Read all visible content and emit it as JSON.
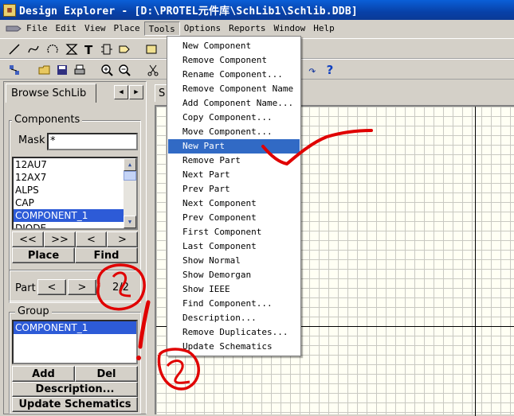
{
  "window": {
    "title": "Design Explorer - [D:\\PROTEL元件库\\SchLib1\\Schlib.DDB]"
  },
  "menubar": {
    "items": [
      {
        "label": "File"
      },
      {
        "label": "Edit"
      },
      {
        "label": "View"
      },
      {
        "label": "Place"
      },
      {
        "label": "Tools"
      },
      {
        "label": "Options"
      },
      {
        "label": "Reports"
      },
      {
        "label": "Window"
      },
      {
        "label": "Help"
      }
    ],
    "active": "Tools"
  },
  "toolbar": {
    "help_glyph": "?",
    "redo_glyph": "↷"
  },
  "panel": {
    "tab_label": "Browse SchLib",
    "components_label": "Components",
    "mask_label": "Mask",
    "mask_value": "*",
    "components": [
      "12AU7",
      "12AX7",
      "ALPS",
      "CAP",
      "COMPONENT_1",
      "DIODE"
    ],
    "selected_component": "COMPONENT_1",
    "nav_first": "<<",
    "nav_last": ">>",
    "nav_prev": "<",
    "nav_next": ">",
    "place_label": "Place",
    "find_label": "Find",
    "part_label": "Part",
    "part_prev": "<",
    "part_next": ">",
    "part_counter": "2/2",
    "group_label": "Group",
    "group_items": [
      "COMPONENT_1"
    ],
    "add_label": "Add",
    "del_label": "Del",
    "description_label": "Description...",
    "update_schematics_label": "Update Schematics"
  },
  "document": {
    "tab_label": "S"
  },
  "tools_menu": {
    "items": [
      "New Component",
      "Remove Component",
      "Rename Component...",
      "Remove Component Name",
      "Add Component Name...",
      "Copy Component...",
      "Move Component...",
      "New Part",
      "Remove Part",
      "Next Part",
      "Prev Part",
      "Next Component",
      "Prev Component",
      "First Component",
      "Last Component",
      "Show Normal",
      "Show Demorgan",
      "Show IEEE",
      "Find Component...",
      "Description...",
      "Remove Duplicates...",
      "Update Schematics"
    ],
    "highlighted": "New Part"
  },
  "colors": {
    "title_bar": "#0a47b8",
    "highlight": "#316ac5",
    "annotation": "#e00000"
  }
}
